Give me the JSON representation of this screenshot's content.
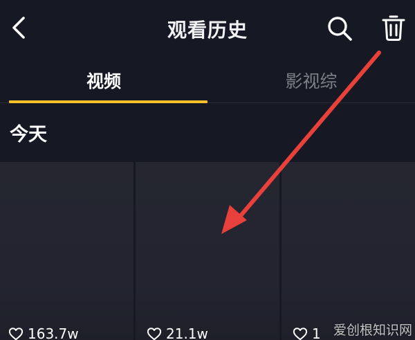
{
  "header": {
    "title": "观看历史",
    "back_icon": "chevron-left-icon",
    "search_icon": "search-icon",
    "delete_icon": "trash-icon"
  },
  "tabs": [
    {
      "label": "视频",
      "active": true
    },
    {
      "label": "影视综",
      "active": false
    }
  ],
  "section": {
    "title": "今天"
  },
  "videos": [
    {
      "likes": "163.7w"
    },
    {
      "likes": "21.1w"
    },
    {
      "likes": "1"
    }
  ],
  "watermark": "爱创根知识网",
  "colors": {
    "background": "#161823",
    "accent": "#f7c229",
    "annotation_arrow": "#e8403a",
    "inactive_tab": "#7d7f88"
  }
}
